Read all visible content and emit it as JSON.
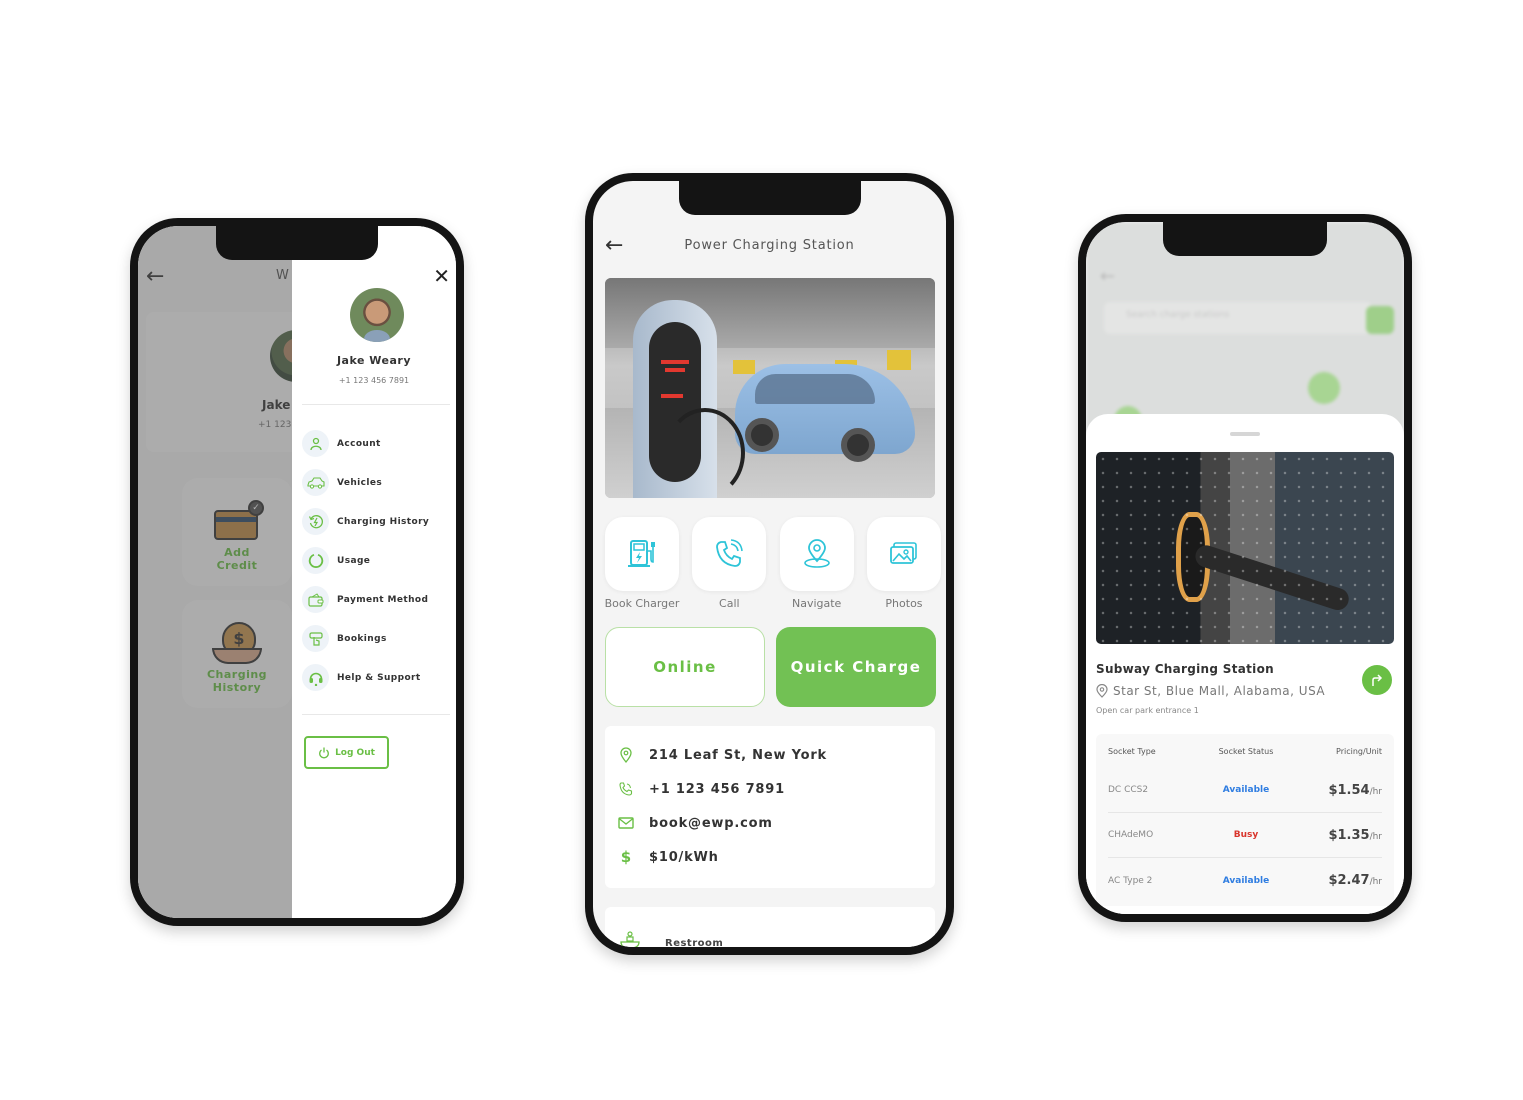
{
  "colors": {
    "accent_green": "#72c154",
    "icon_teal": "#2ec4d8",
    "status_available": "#2f7de1",
    "status_busy": "#d9342b"
  },
  "left_phone": {
    "background_screen": {
      "title_fragment": "W",
      "profile_name": "Jake",
      "profile_phone": "+1 123",
      "tiles": [
        {
          "label_line1": "Add",
          "label_line2": "Credit",
          "icon": "credit-card-icon"
        },
        {
          "label_line1": "Charging",
          "label_line2": "History",
          "icon": "money-bag-icon"
        }
      ]
    },
    "drawer": {
      "user_name": "Jake Weary",
      "user_phone": "+1 123 456 7891",
      "menu": [
        {
          "label": "Account",
          "icon": "user-icon"
        },
        {
          "label": "Vehicles",
          "icon": "car-icon"
        },
        {
          "label": "Charging History",
          "icon": "history-icon"
        },
        {
          "label": "Usage",
          "icon": "usage-icon"
        },
        {
          "label": "Payment Method",
          "icon": "wallet-icon"
        },
        {
          "label": "Bookings",
          "icon": "bookings-icon"
        },
        {
          "label": "Help & Support",
          "icon": "headset-icon"
        }
      ],
      "logout_label": "Log Out"
    }
  },
  "center_phone": {
    "title": "Power Charging Station",
    "actions": [
      {
        "label": "Book Charger",
        "icon": "charger-icon"
      },
      {
        "label": "Call",
        "icon": "phone-icon"
      },
      {
        "label": "Navigate",
        "icon": "location-pin-icon"
      },
      {
        "label": "Photos",
        "icon": "photos-icon"
      }
    ],
    "online_label": "Online",
    "quick_charge_label": "Quick Charge",
    "info": {
      "address": "214 Leaf St, New York",
      "phone": "+1 123 456 7891",
      "email": "book@ewp.com",
      "price": "$10/kWh"
    },
    "amenities": [
      {
        "label": "Restroom",
        "icon": "restroom-icon"
      }
    ]
  },
  "right_phone": {
    "map": {
      "search_placeholder": "Search charge stations"
    },
    "station": {
      "name": "Subway Charging Station",
      "address": "Star St, Blue Mall, Alabama, USA",
      "note": "Open car park entrance 1"
    },
    "socket_table": {
      "headers": [
        "Socket Type",
        "Socket Status",
        "Pricing/Unit"
      ],
      "rows": [
        {
          "type": "DC CCS2",
          "status": "Available",
          "status_kind": "available",
          "price": "$1.54",
          "unit": "/hr"
        },
        {
          "type": "CHAdeMO",
          "status": "Busy",
          "status_kind": "busy",
          "price": "$1.35",
          "unit": "/hr"
        },
        {
          "type": "AC Type 2",
          "status": "Available",
          "status_kind": "available",
          "price": "$2.47",
          "unit": "/hr"
        }
      ]
    }
  }
}
